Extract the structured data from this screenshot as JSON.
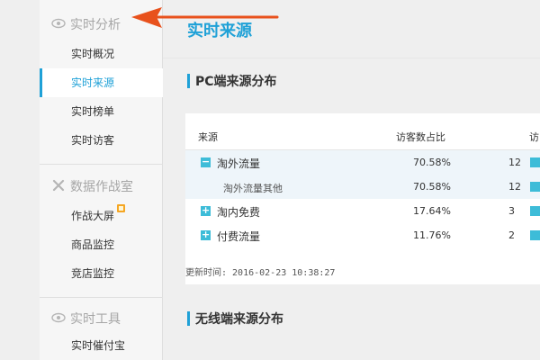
{
  "sidebar": {
    "groups": [
      {
        "title": "实时分析",
        "icon": "eye-icon",
        "items": [
          {
            "label": "实时概况"
          },
          {
            "label": "实时来源"
          },
          {
            "label": "实时榜单"
          },
          {
            "label": "实时访客"
          }
        ]
      },
      {
        "title": "数据作战室",
        "icon": "close-icon",
        "items": [
          {
            "label": "作战大屏"
          },
          {
            "label": "商品监控"
          },
          {
            "label": "竞店监控"
          }
        ]
      },
      {
        "title": "实时工具",
        "icon": "eye-icon",
        "items": [
          {
            "label": "实时催付宝"
          }
        ]
      }
    ],
    "active_item": "实时来源"
  },
  "main": {
    "title": "实时来源",
    "pc_section": {
      "heading": "PC端来源分布",
      "columns": {
        "source": "来源",
        "visitor_share": "访客数占比",
        "visitors_truncated": "访"
      },
      "rows": [
        {
          "name": "淘外流量",
          "pct": "70.58%",
          "count": "12",
          "expander": "−"
        },
        {
          "name": "淘外流量其他",
          "pct": "70.58%",
          "count": "12"
        },
        {
          "name": "淘内免费",
          "pct": "17.64%",
          "count": "3",
          "expander": "+"
        },
        {
          "name": "付费流量",
          "pct": "11.76%",
          "count": "2",
          "expander": "+"
        }
      ],
      "update_time": "更新时间: 2016-02-23 10:38:27"
    },
    "wireless_section": {
      "heading": "无线端来源分布"
    }
  },
  "colors": {
    "accent": "#1fa1d7",
    "arrow": "#e8511c",
    "row_icon": "#3dbcd8"
  }
}
